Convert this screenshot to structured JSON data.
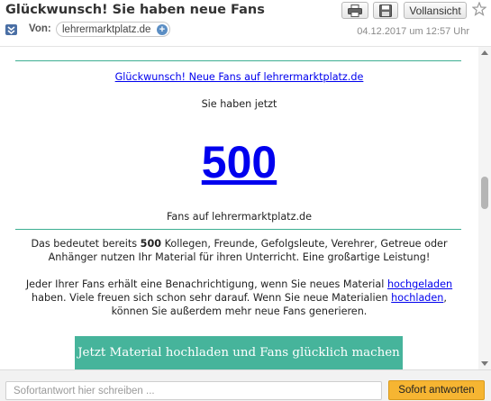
{
  "header": {
    "subject": "Glückwunsch! Sie haben neue Fans",
    "print_icon": "printer-icon",
    "save_icon": "floppy-disk-icon",
    "full_view_label": "Vollansicht",
    "star_icon": "star-outline-icon",
    "expand_icon": "chevron-double-down-icon",
    "from_label": "Von:",
    "sender": "lehrermarktplatz.de",
    "sender_add_icon": "plus-circle-icon",
    "sender_add_symbol": "+",
    "timestamp": "04.12.2017 um 12:57 Uhr"
  },
  "mail": {
    "title_link": "Glückwunsch! Neue Fans auf lehrermarktplatz.de",
    "intro": "Sie haben jetzt",
    "fan_count": "500",
    "fans_on": "Fans auf lehrermarktplatz.de",
    "para1_before": "Das bedeutet bereits ",
    "para1_count": "500",
    "para1_after": " Kollegen, Freunde, Gefolgsleute, Verehrer, Getreue oder Anhänger nutzen Ihr Material für ihren Unterricht. Eine großartige Leistung!",
    "para2_part1": "Jeder Ihrer Fans erhält eine Benachrichtigung, wenn Sie neues Material ",
    "para2_link1": "hochgeladen",
    "para2_part2": " haben. Viele freuen sich schon sehr darauf. Wenn Sie neue Materialien ",
    "para2_link2": "hochladen",
    "para2_part3": ", können Sie außerdem mehr neue Fans generieren.",
    "cta_label": "Jetzt Material hochladen und Fans glücklich machen"
  },
  "footer": {
    "reply_placeholder": "Sofortantwort hier schreiben ...",
    "reply_button": "Sofort antworten"
  },
  "colors": {
    "accent_green": "#46b49b",
    "link_blue": "#0000ee",
    "reply_button": "#f6b532"
  }
}
